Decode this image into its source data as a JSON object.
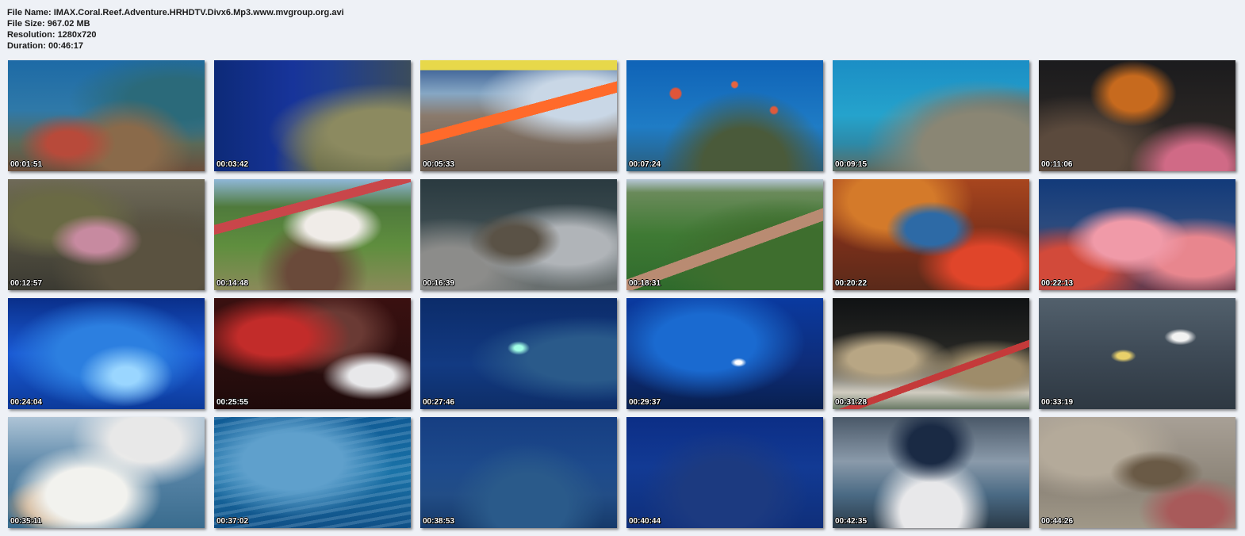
{
  "info": {
    "file_name_label": "File Name:",
    "file_name": "IMAX.Coral.Reef.Adventure.HRHDTV.Divx6.Mp3.www.mvgroup.org.avi",
    "file_size_label": "File Size:",
    "file_size": "967.02 MB",
    "resolution_label": "Resolution:",
    "resolution": "1280x720",
    "duration_label": "Duration:",
    "duration": "00:46:17"
  },
  "thumbnails": [
    {
      "time": "00:01:51"
    },
    {
      "time": "00:03:42"
    },
    {
      "time": "00:05:33"
    },
    {
      "time": "00:07:24"
    },
    {
      "time": "00:09:15"
    },
    {
      "time": "00:11:06"
    },
    {
      "time": "00:12:57"
    },
    {
      "time": "00:14:48"
    },
    {
      "time": "00:16:39"
    },
    {
      "time": "00:18:31"
    },
    {
      "time": "00:20:22"
    },
    {
      "time": "00:22:13"
    },
    {
      "time": "00:24:04"
    },
    {
      "time": "00:25:55"
    },
    {
      "time": "00:27:46"
    },
    {
      "time": "00:29:37"
    },
    {
      "time": "00:31:28"
    },
    {
      "time": "00:33:19"
    },
    {
      "time": "00:35:11"
    },
    {
      "time": "00:37:02"
    },
    {
      "time": "00:38:53"
    },
    {
      "time": "00:40:44"
    },
    {
      "time": "00:42:35"
    },
    {
      "time": "00:44:26"
    }
  ]
}
